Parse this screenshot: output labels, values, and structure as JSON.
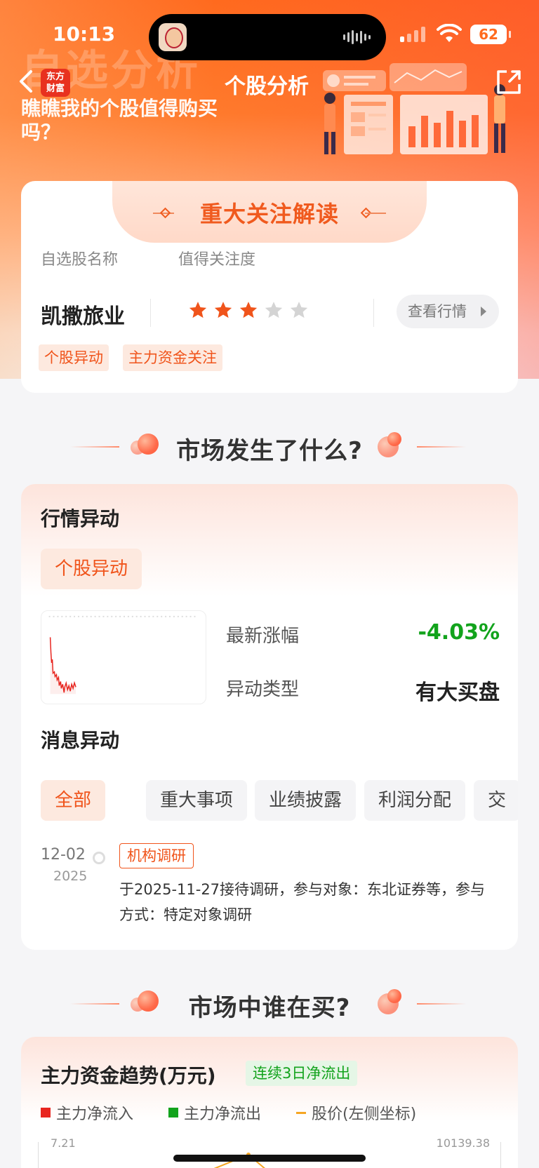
{
  "status_bar": {
    "time": "10:13",
    "battery": "62"
  },
  "hero": {
    "watermark": "自选分析",
    "slogan": "瞧瞧我的个股值得购买吗？"
  },
  "nav": {
    "logo_line1": "东方",
    "logo_line2": "财富",
    "title": "个股分析"
  },
  "focus_card": {
    "title": "重大关注解读",
    "name_label": "自选股名称",
    "attention_label": "值得关注度",
    "stock_name": "凯撒旅业",
    "attention_stars": 3,
    "attention_max": 5,
    "quote_button": "查看行情",
    "tags": [
      "个股异动",
      "主力资金关注"
    ]
  },
  "section_market": {
    "title": "市场发生了什么?"
  },
  "market_card": {
    "quote_title": "行情异动",
    "quote_chip": "个股异动",
    "latest_change_label": "最新涨幅",
    "latest_change_value": "-4.03%",
    "anomaly_type_label": "异动类型",
    "anomaly_type_value": "有大买盘",
    "news_title": "消息异动",
    "filters": [
      "全部",
      "重大事项",
      "业绩披露",
      "利润分配",
      "交"
    ],
    "news": {
      "date": "12-02",
      "year": "2025",
      "tag": "机构调研",
      "text": "于2025-11-27接待调研，参与对象：东北证券等，参与方式：特定对象调研"
    }
  },
  "section_buyers": {
    "title": "市场中谁在买?"
  },
  "fund_card": {
    "title": "主力资金趋势(万元)",
    "badge": "连续3日净流出",
    "legend": [
      "主力净流入",
      "主力净流出",
      "股价(左侧坐标)"
    ],
    "axis_left_top": "7.21",
    "axis_right_top": "10139.38"
  },
  "colors": {
    "accent": "#f0541b",
    "down": "#12a31c",
    "inflow": "#e8251f",
    "outflow": "#12a31c",
    "price": "#f5a623"
  }
}
